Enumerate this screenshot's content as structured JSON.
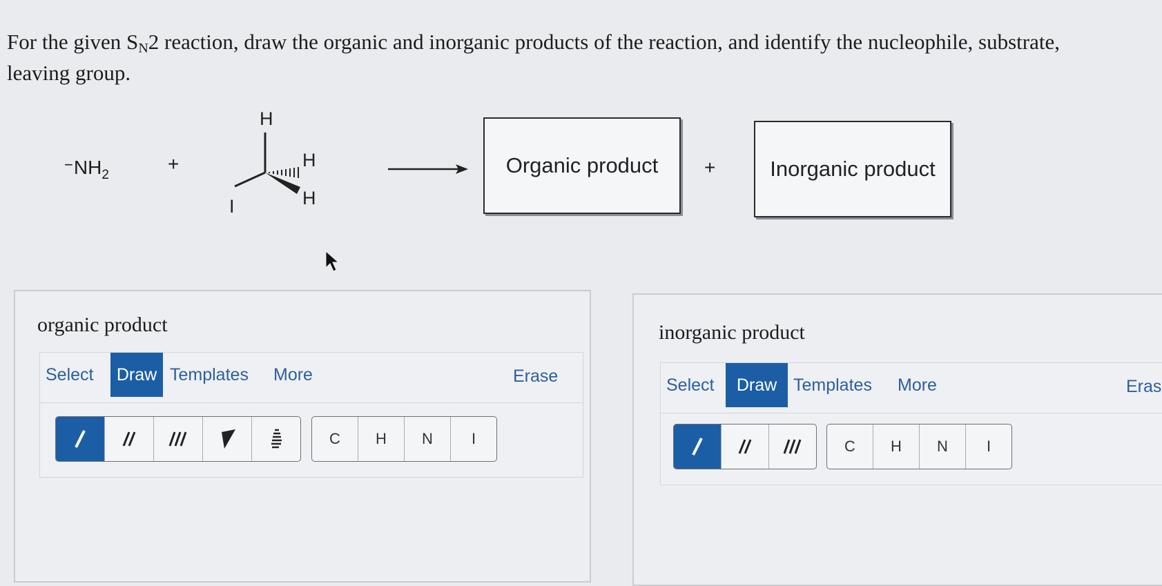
{
  "question": {
    "before": "For the given S",
    "sub": "N",
    "after": "2 reaction, draw the organic and inorganic products of the reaction, and identify the nucleophile, substrate,",
    "line2": "leaving group."
  },
  "reaction": {
    "nucleophile_charge": "−",
    "nucleophile_base": "NH",
    "nucleophile_sub": "2",
    "plus": "+",
    "substrate_atoms": {
      "top": "H",
      "right": "H",
      "bottom": "H",
      "left": "I"
    },
    "organic_box": "Organic product",
    "inorganic_box": "Inorganic product"
  },
  "panels": [
    {
      "title": "organic product",
      "tabs": [
        "Select",
        "Draw",
        "Templates",
        "More"
      ],
      "active_tab": "Draw",
      "erase": "Erase",
      "bond_tools": [
        "single-bond-icon",
        "double-bond-icon",
        "triple-bond-icon",
        "wedge-bond-icon",
        "hash-bond-icon"
      ],
      "atoms": [
        "C",
        "H",
        "N",
        "I"
      ]
    },
    {
      "title": "inorganic product",
      "tabs": [
        "Select",
        "Draw",
        "Templates",
        "More"
      ],
      "active_tab": "Draw",
      "erase": "Erase",
      "bond_tools": [
        "single-bond-icon",
        "double-bond-icon",
        "triple-bond-icon"
      ],
      "atoms": [
        "C",
        "H",
        "N",
        "I"
      ]
    }
  ],
  "colors": {
    "accent": "#1b5ea5",
    "link": "#2e5f9c"
  }
}
